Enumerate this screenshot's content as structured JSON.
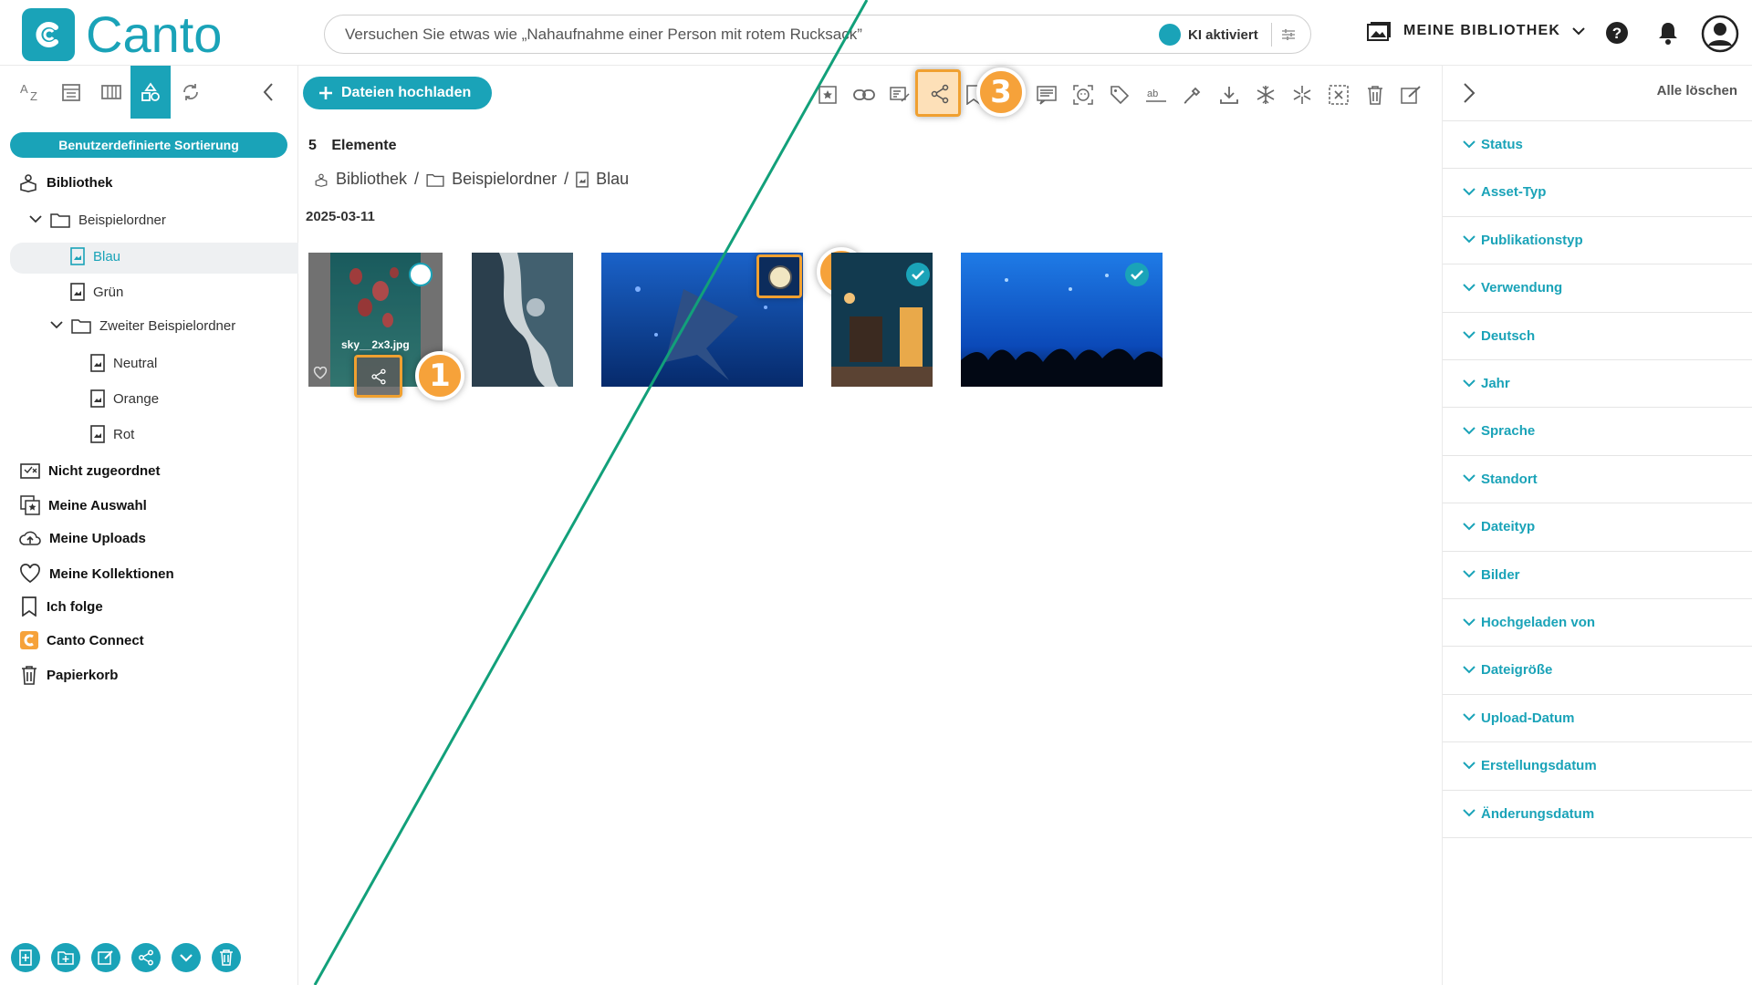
{
  "app": {
    "name": "Canto"
  },
  "search": {
    "placeholder": "Versuchen Sie etwas wie „Nahaufnahme einer Person mit rotem Rucksack”",
    "ai_label": "KI aktiviert"
  },
  "header": {
    "library_label": "MEINE BIBLIOTHEK"
  },
  "sidebar": {
    "sort_button": "Benutzerdefinierte Sortierung",
    "tree": {
      "library": "Bibliothek",
      "folder1": "Beispielordner",
      "blau": "Blau",
      "gruen": "Grün",
      "folder2": "Zweiter Beispielordner",
      "neutral": "Neutral",
      "orange": "Orange",
      "rot": "Rot"
    },
    "nav": {
      "unassigned": "Nicht zugeordnet",
      "my_selection": "Meine Auswahl",
      "my_uploads": "Meine Uploads",
      "my_collections": "Meine Kollektionen",
      "following": "Ich folge",
      "canto_connect": "Canto Connect",
      "trash": "Papierkorb"
    }
  },
  "main": {
    "upload_button": "Dateien hochladen",
    "count_number": "5",
    "count_label": "Elemente",
    "breadcrumb": {
      "root": "Bibliothek",
      "folder": "Beispielordner",
      "current": "Blau"
    },
    "date_group": "2025-03-11",
    "first_thumb_filename": "sky__2x3.jpg"
  },
  "callouts": {
    "one": "1",
    "two": "2",
    "three": "3"
  },
  "filters": {
    "clear_all": "Alle löschen",
    "items": [
      "Status",
      "Asset-Typ",
      "Publikationstyp",
      "Verwendung",
      "Deutsch",
      "Jahr",
      "Sprache",
      "Standort",
      "Dateityp",
      "Bilder",
      "Hochgeladen von",
      "Dateigröße",
      "Upload-Datum",
      "Erstellungsdatum",
      "Änderungsdatum"
    ]
  },
  "colors": {
    "accent": "#1aa3b8",
    "callout": "#f6a23a",
    "annotation_line": "#12a07a"
  }
}
